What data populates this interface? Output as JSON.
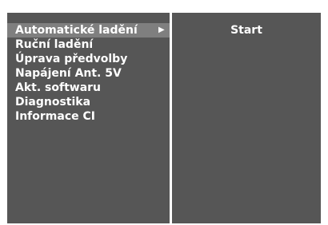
{
  "menu": {
    "items": [
      {
        "label": "Automatické ladění",
        "arrow": "▶",
        "selected": true
      },
      {
        "label": "Ruční ladění"
      },
      {
        "label": "Úprava předvolby"
      },
      {
        "label": "Napájení Ant. 5V"
      },
      {
        "label": "Akt. softwaru"
      },
      {
        "label": "Diagnostika"
      },
      {
        "label": "Informace CI"
      }
    ]
  },
  "submenu": {
    "items": [
      {
        "label": "Start"
      }
    ]
  },
  "colors": {
    "panel_bg": "#565656",
    "highlight_bg": "#7f7f7f",
    "text": "#ffffff",
    "divider": "#ffffff"
  }
}
